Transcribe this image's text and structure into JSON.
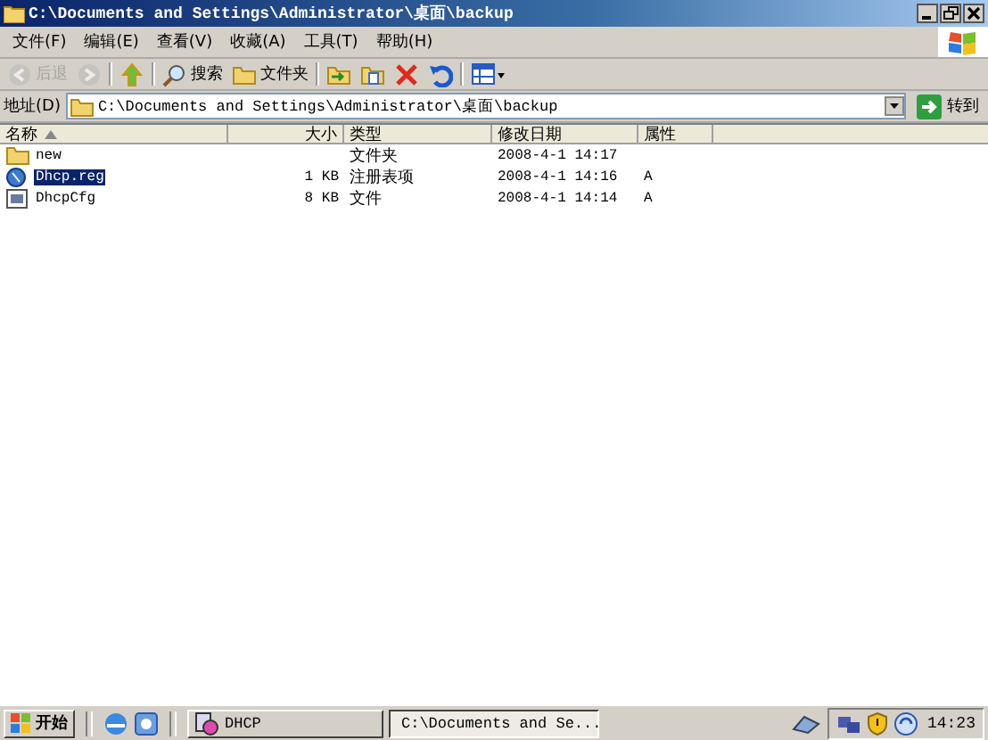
{
  "window": {
    "title": "C:\\Documents and Settings\\Administrator\\桌面\\backup"
  },
  "menu": [
    "文件(F)",
    "编辑(E)",
    "查看(V)",
    "收藏(A)",
    "工具(T)",
    "帮助(H)"
  ],
  "toolbar": [
    {
      "kind": "back",
      "label": "后退",
      "disabled": true
    },
    {
      "kind": "forward",
      "disabled": true
    },
    {
      "kind": "up",
      "disabled": false
    },
    {
      "kind": "search",
      "label": "搜索",
      "disabled": false
    },
    {
      "kind": "folders",
      "label": "文件夹",
      "disabled": false
    },
    {
      "kind": "move",
      "disabled": false
    },
    {
      "kind": "copy",
      "disabled": false
    },
    {
      "kind": "delete",
      "disabled": false
    },
    {
      "kind": "undo",
      "disabled": false
    },
    {
      "kind": "views",
      "disabled": false
    }
  ],
  "address": {
    "label": "地址(D)",
    "value": "C:\\Documents and Settings\\Administrator\\桌面\\backup",
    "go": "转到"
  },
  "columns": [
    "名称",
    "大小",
    "类型",
    "修改日期",
    "属性"
  ],
  "rows": [
    {
      "kind": "folder",
      "name": "new",
      "size": "",
      "type": "文件夹",
      "date": "2008-4-1 14:17",
      "attr": "",
      "selected": false
    },
    {
      "kind": "reg",
      "name": "Dhcp.reg",
      "size": "1 KB",
      "type": "注册表项",
      "date": "2008-4-1 14:16",
      "attr": "A",
      "selected": true
    },
    {
      "kind": "file",
      "name": "DhcpCfg",
      "size": "8 KB",
      "type": "文件",
      "date": "2008-4-1 14:14",
      "attr": "A",
      "selected": false
    }
  ],
  "taskbar": {
    "start": "开始",
    "tasks": [
      {
        "kind": "dhcp",
        "label": "DHCP",
        "selected": false
      },
      {
        "kind": "folder",
        "label": "C:\\Documents and Se...",
        "selected": true
      }
    ],
    "clock": "14:23"
  }
}
